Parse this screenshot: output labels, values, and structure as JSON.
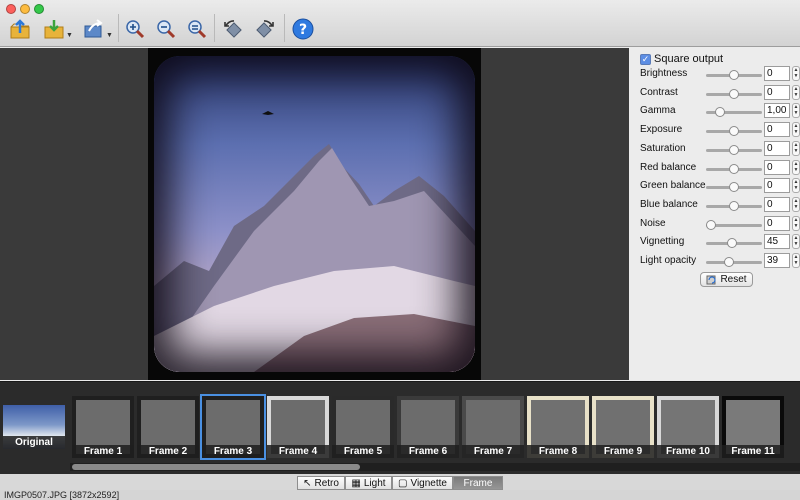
{
  "toolbar": {
    "buttons": [
      {
        "icon": "open-icon"
      },
      {
        "icon": "save-icon"
      },
      {
        "icon": "share-icon"
      },
      {
        "icon": "zoom-in-icon"
      },
      {
        "icon": "zoom-out-icon"
      },
      {
        "icon": "zoom-fit-icon"
      },
      {
        "icon": "rotate-left-icon"
      },
      {
        "icon": "rotate-right-icon"
      },
      {
        "icon": "help-icon"
      }
    ]
  },
  "panel": {
    "square_output_label": "Square output",
    "square_output_checked": true,
    "adjustments": [
      {
        "label": "Brightness",
        "value": "0",
        "level": 0.5
      },
      {
        "label": "Contrast",
        "value": "0",
        "level": 0.5
      },
      {
        "label": "Gamma",
        "value": "1,00",
        "level": 0.2
      },
      {
        "label": "Exposure",
        "value": "0",
        "level": 0.5
      },
      {
        "label": "Saturation",
        "value": "0",
        "level": 0.5
      },
      {
        "label": "Red balance",
        "value": "0",
        "level": 0.5
      },
      {
        "label": "Green balance",
        "value": "0",
        "level": 0.5
      },
      {
        "label": "Blue balance",
        "value": "0",
        "level": 0.5
      },
      {
        "label": "Noise",
        "value": "0",
        "level": 0.0
      },
      {
        "label": "Vignetting",
        "value": "45",
        "level": 0.45
      },
      {
        "label": "Light opacity",
        "value": "39",
        "level": 0.39
      }
    ],
    "reset_label": "Reset"
  },
  "filmstrip": {
    "original_label": "Original",
    "frames": [
      "Frame 1",
      "Frame 2",
      "Frame 3",
      "Frame 4",
      "Frame 5",
      "Frame 6",
      "Frame 7",
      "Frame 8",
      "Frame 9",
      "Frame 10",
      "Frame 11"
    ],
    "selected_frame": "Frame 3"
  },
  "modes": {
    "tabs": [
      "Retro",
      "Light",
      "Vignette",
      "Frame"
    ],
    "active": "Frame"
  },
  "status": {
    "file_info": "IMGP0507.JPG [3872x2592]"
  }
}
